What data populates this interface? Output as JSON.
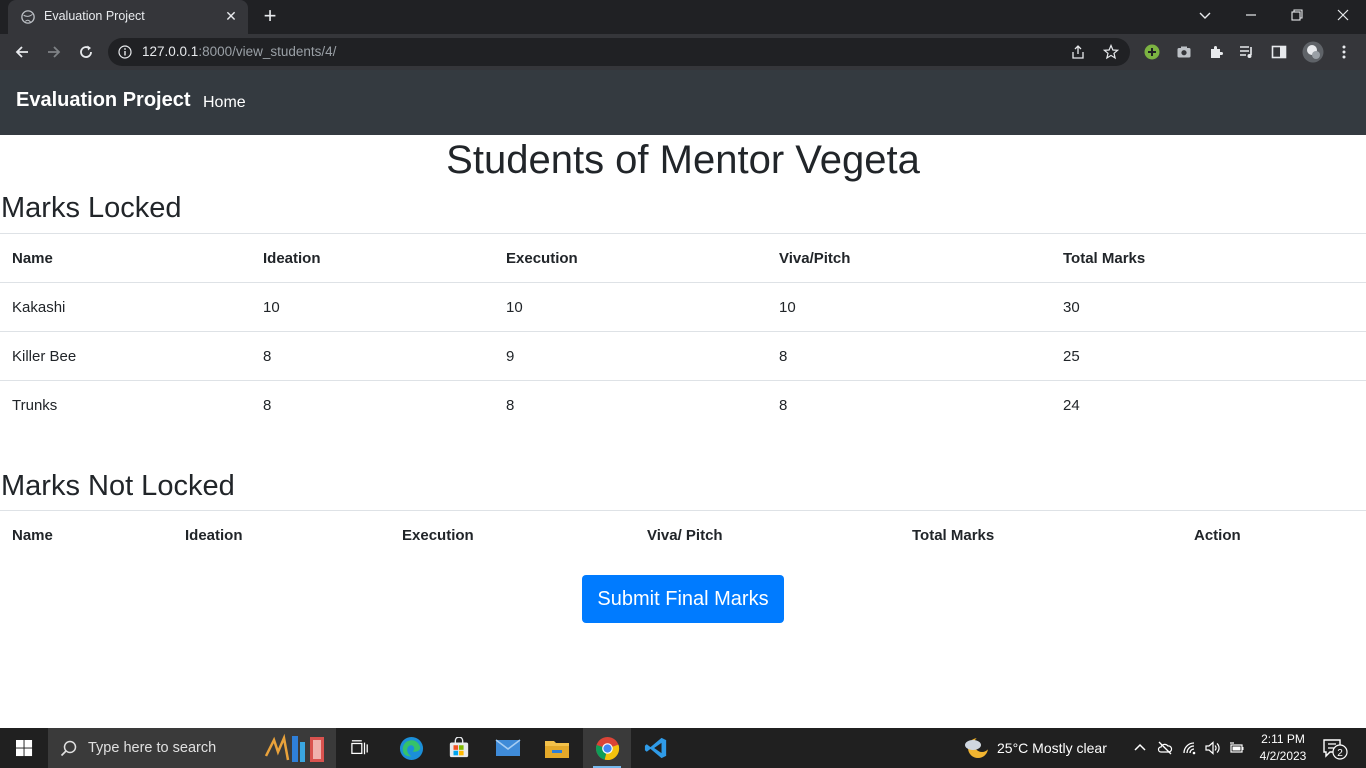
{
  "browser": {
    "tab_title": "Evaluation Project",
    "url_host": "127.0.0.1",
    "url_path": ":8000/view_students/4/"
  },
  "navbar": {
    "brand": "Evaluation Project",
    "home_link": "Home"
  },
  "page": {
    "title": "Students of Mentor Vegeta"
  },
  "locked": {
    "heading": "Marks Locked",
    "columns": [
      "Name",
      "Ideation",
      "Execution",
      "Viva/Pitch",
      "Total Marks"
    ],
    "rows": [
      [
        "Kakashi",
        "10",
        "10",
        "10",
        "30"
      ],
      [
        "Killer Bee",
        "8",
        "9",
        "8",
        "25"
      ],
      [
        "Trunks",
        "8",
        "8",
        "8",
        "24"
      ]
    ]
  },
  "not_locked": {
    "heading": "Marks Not Locked",
    "columns": [
      "Name",
      "Ideation",
      "Execution",
      "Viva/ Pitch",
      "Total Marks",
      "Action"
    ],
    "rows": []
  },
  "submit_label": "Submit Final Marks",
  "taskbar": {
    "search_placeholder": "Type here to search",
    "weather": "25°C  Mostly clear",
    "time": "2:11 PM",
    "date": "4/2/2023",
    "notification_count": "2"
  },
  "icons": {
    "accent_blue": "#007bff",
    "navbar_bg": "#343a40"
  }
}
